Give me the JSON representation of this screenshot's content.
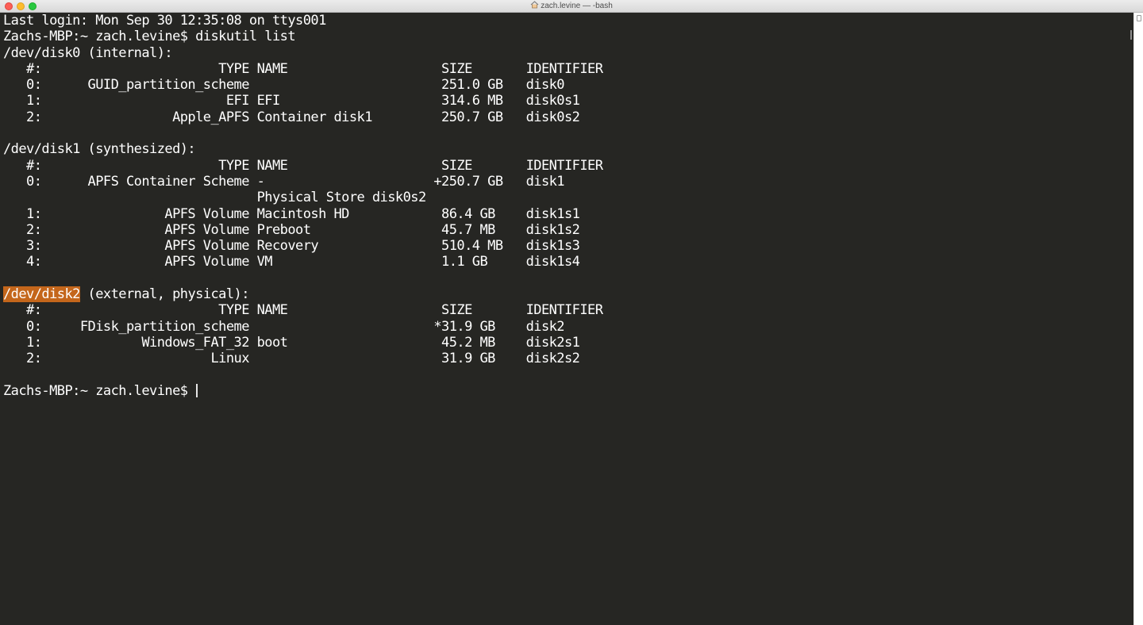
{
  "window": {
    "title": "zach.levine — -bash",
    "title_icon": "home-icon"
  },
  "terminal": {
    "colors": {
      "background": "#262623",
      "foreground": "#ffffff",
      "selection": "#c4661b"
    },
    "lines": [
      {
        "text": "Last login: Mon Sep 30 12:35:08 on ttys001"
      },
      {
        "text": "Zachs-MBP:~ zach.levine$ diskutil list"
      },
      {
        "text": "/dev/disk0 (internal):"
      },
      {
        "text": "   #:                       TYPE NAME                    SIZE       IDENTIFIER"
      },
      {
        "text": "   0:      GUID_partition_scheme                         251.0 GB   disk0"
      },
      {
        "text": "   1:                        EFI EFI                     314.6 MB   disk0s1"
      },
      {
        "text": "   2:                 Apple_APFS Container disk1         250.7 GB   disk0s2"
      },
      {
        "text": ""
      },
      {
        "text": "/dev/disk1 (synthesized):"
      },
      {
        "text": "   #:                       TYPE NAME                    SIZE       IDENTIFIER"
      },
      {
        "text": "   0:      APFS Container Scheme -                      +250.7 GB   disk1"
      },
      {
        "text": "                                 Physical Store disk0s2"
      },
      {
        "text": "   1:                APFS Volume Macintosh HD            86.4 GB    disk1s1"
      },
      {
        "text": "   2:                APFS Volume Preboot                 45.7 MB    disk1s2"
      },
      {
        "text": "   3:                APFS Volume Recovery                510.4 MB   disk1s3"
      },
      {
        "text": "   4:                APFS Volume VM                      1.1 GB     disk1s4"
      },
      {
        "text": ""
      },
      {
        "text": " (external, physical):",
        "highlight": "/dev/disk2"
      },
      {
        "text": "   #:                       TYPE NAME                    SIZE       IDENTIFIER"
      },
      {
        "text": "   0:     FDisk_partition_scheme                        *31.9 GB    disk2"
      },
      {
        "text": "   1:             Windows_FAT_32 boot                    45.2 MB    disk2s1"
      },
      {
        "text": "   2:                      Linux                         31.9 GB    disk2s2"
      },
      {
        "text": ""
      },
      {
        "text": "Zachs-MBP:~ zach.levine$ ",
        "cursor": true
      }
    ]
  }
}
